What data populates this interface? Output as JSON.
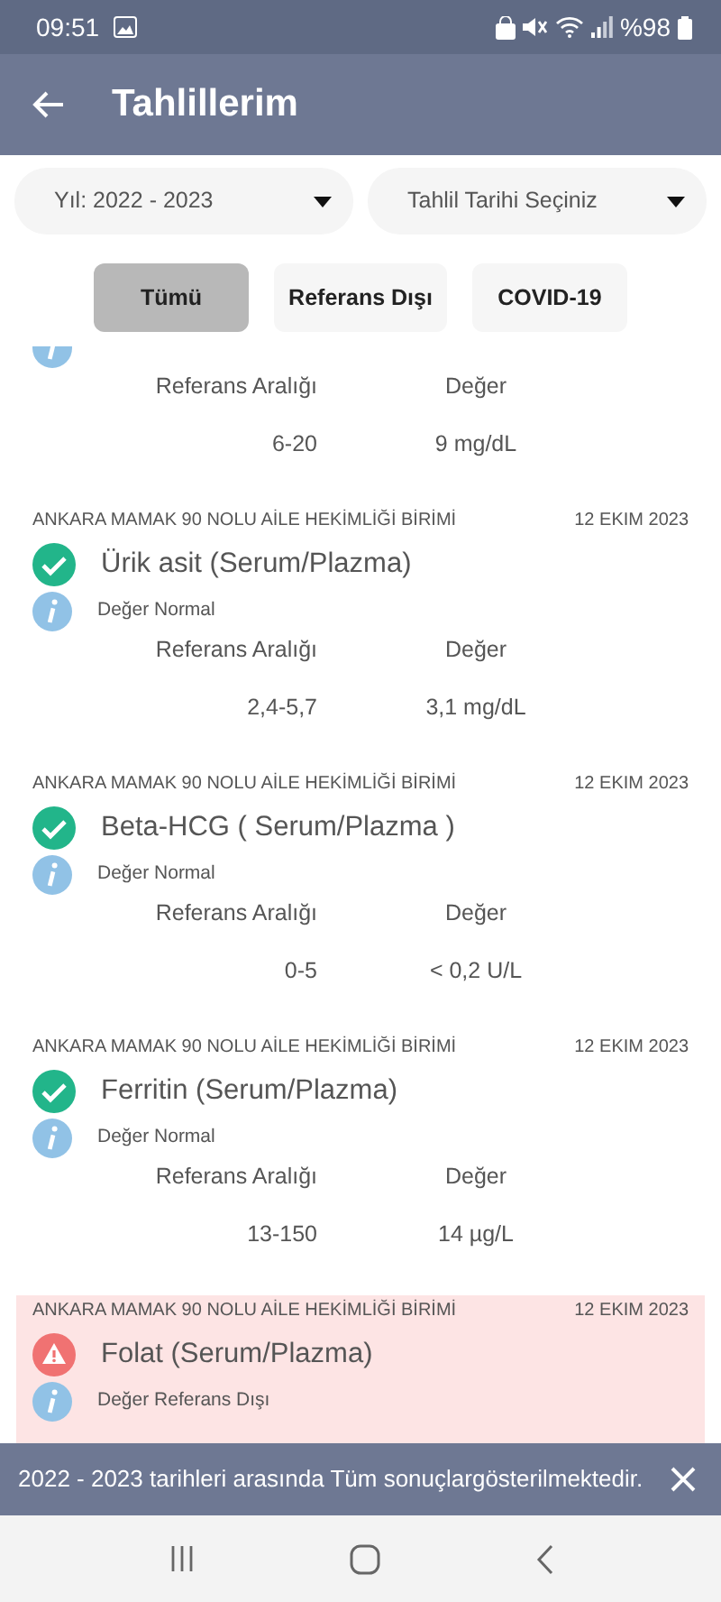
{
  "status_bar": {
    "time": "09:51",
    "battery": "%98"
  },
  "app_bar": {
    "title": "Tahlillerim"
  },
  "filters": [
    {
      "label": "Yıl: 2022 - 2023"
    },
    {
      "label": "Tahlil Tarihi Seçiniz"
    }
  ],
  "tabs": [
    {
      "label": "Tümü",
      "selected": true
    },
    {
      "label": "Referans Dışı",
      "selected": false
    },
    {
      "label": "COVID-19",
      "selected": false
    }
  ],
  "results": [
    {
      "range_label": "Referans Aralığı",
      "value_label": "Değer",
      "range": "6-20",
      "value": "9 mg/dL"
    },
    {
      "out_of_range": false,
      "lab": "ANKARA MAMAK 90 NOLU AİLE HEKİMLİĞİ BİRİMİ",
      "date": "12 EKIM 2023",
      "name": "Ürik asit (Serum/Plazma)",
      "note": "Değer Normal",
      "range_label": "Referans Aralığı",
      "value_label": "Değer",
      "range": "2,4-5,7",
      "value": "3,1 mg/dL"
    },
    {
      "out_of_range": false,
      "lab": "ANKARA MAMAK 90 NOLU AİLE HEKİMLİĞİ BİRİMİ",
      "date": "12 EKIM 2023",
      "name": "Beta-HCG ( Serum/Plazma )",
      "note": "Değer Normal",
      "range_label": "Referans Aralığı",
      "value_label": "Değer",
      "range": "0-5",
      "value": "< 0,2 U/L"
    },
    {
      "out_of_range": false,
      "lab": "ANKARA MAMAK 90 NOLU AİLE HEKİMLİĞİ BİRİMİ",
      "date": "12 EKIM 2023",
      "name": "Ferritin (Serum/Plazma)",
      "note": "Değer Normal",
      "range_label": "Referans Aralığı",
      "value_label": "Değer",
      "range": "13-150",
      "value": "14 µg/L"
    },
    {
      "out_of_range": true,
      "lab": "ANKARA MAMAK 90 NOLU AİLE HEKİMLİĞİ BİRİMİ",
      "date": "12 EKIM 2023",
      "name": "Folat (Serum/Plazma)",
      "note": "Değer Referans Dışı"
    }
  ],
  "snackbar": {
    "message": "2022 - 2023 tarihleri arasında Tüm sonuçlargösterilmektedir."
  }
}
